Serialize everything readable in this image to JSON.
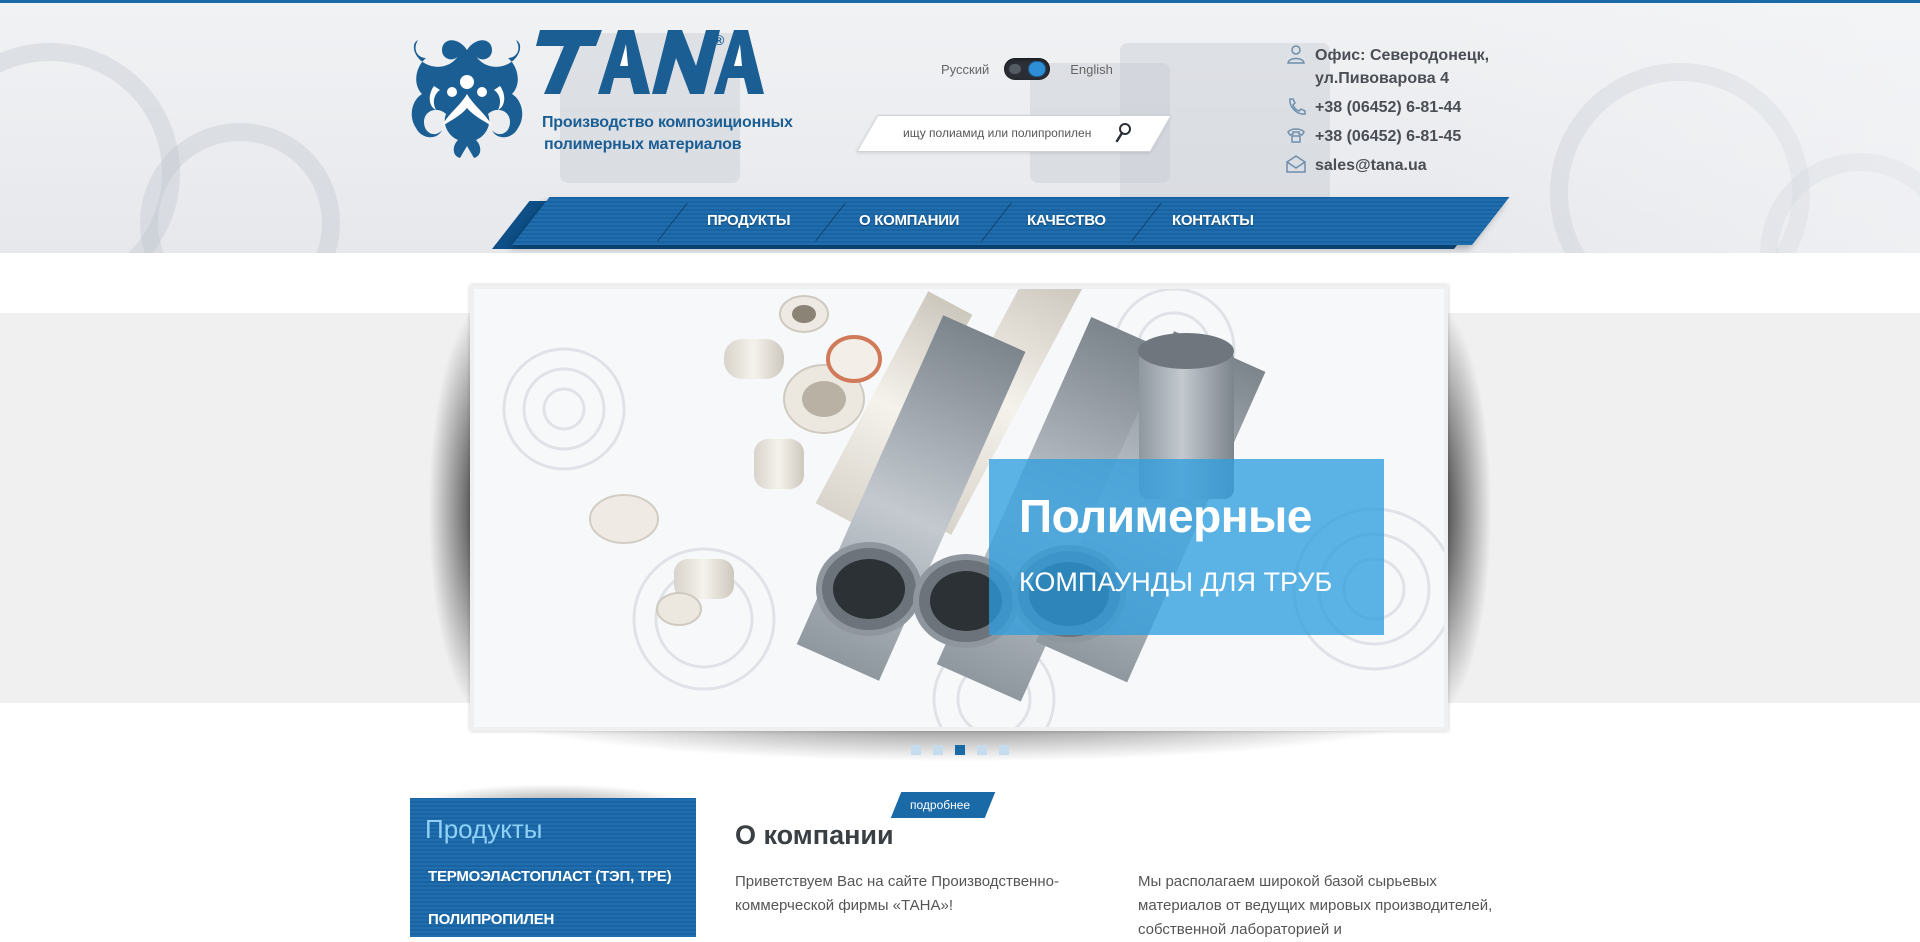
{
  "header": {
    "logo_word": "TANA",
    "logo_reg": "®",
    "tagline_line1": "Производство композиционных",
    "tagline_line2": "полимерных материалов",
    "lang_ru": "Русский",
    "lang_en": "English",
    "search_placeholder": "ищу полиамид или полипропилен"
  },
  "contacts": {
    "office_line1": "Офис: Северодонецк,",
    "office_line2": "ул.Пивоварова 4",
    "phone1": "+38 (06452) 6-81-44",
    "phone2": "+38 (06452) 6-81-45",
    "email": "sales@tana.ua"
  },
  "nav": {
    "items": [
      "ПРОДУКТЫ",
      "О КОМПАНИИ",
      "КАЧЕСТВО",
      "КОНТАКТЫ"
    ]
  },
  "slider": {
    "title": "Полимерные",
    "subtitle": "КОМПАУНДЫ ДЛЯ ТРУБ",
    "dots_count": 5,
    "active_index": 2
  },
  "products": {
    "title": "Продукты",
    "items": [
      "ТЕРМОЭЛАСТОПЛАСТ (ТЭП, TPE)",
      "ПОЛИПРОПИЛЕН"
    ]
  },
  "about": {
    "more_label": "подробнее",
    "title": "О компании",
    "col1": "Приветствуем Вас на сайте Производственно-коммерческой фирмы «ТАНА»!",
    "col2": "Мы располагаем широкой базой сырьевых материалов от ведущих мировых производителей, собственной лабораторией и"
  },
  "colors": {
    "brand_blue": "#1b6aa8",
    "caption_blue": "#309ede",
    "products_title": "#8fd1f7"
  }
}
